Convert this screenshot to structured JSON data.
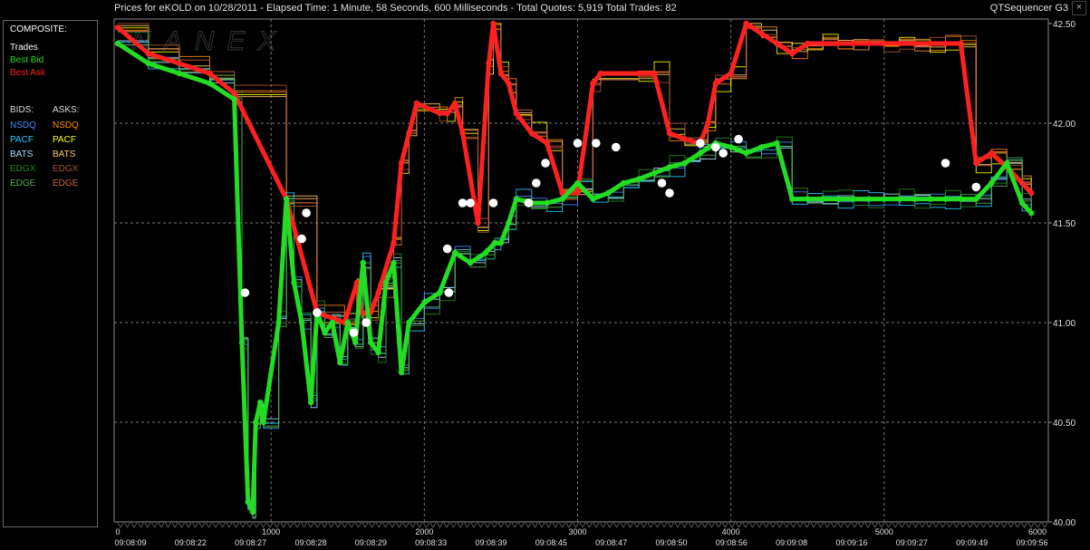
{
  "header": {
    "title": "Prices for  eKOLD  on  10/28/2011  -  Elapsed Time: 1 Minute, 58 Seconds, 600 Milliseconds  -  Total Quotes: 5,919  Total Trades: 82",
    "app_name": "QTSequencer G3",
    "close_glyph": "×"
  },
  "watermark": "NANEX",
  "legend": {
    "composite_label": "COMPOSITE:",
    "trades": "Trades",
    "best_bid": "Best Bid",
    "best_ask": "Best Ask",
    "bids_label": "BIDS:",
    "asks_label": "ASKS:",
    "bids": [
      "NSDQ",
      "PACF",
      "BATS",
      "EDGX",
      "EDGE"
    ],
    "asks": [
      "NSDQ",
      "PACF",
      "BATS",
      "EDGX",
      "EDGE"
    ]
  },
  "colors": {
    "trades": "#ffffff",
    "best_bid": "#22dd22",
    "best_ask": "#ff2020",
    "NSDQ_bid": "#4488ff",
    "NSDQ_ask": "#ff8800",
    "PACF_bid": "#22ccff",
    "PACF_ask": "#ffff00",
    "BATS_bid": "#aaddff",
    "BATS_ask": "#ffcc66",
    "EDGX_bid": "#228822",
    "EDGX_ask": "#aa5533",
    "EDGE_bid": "#55aa55",
    "EDGE_ask": "#cc6644"
  },
  "chart_data": {
    "type": "line",
    "ylim": [
      40.0,
      42.5
    ],
    "xlim": [
      0,
      6000
    ],
    "y_ticks": [
      "42.50",
      "42.00",
      "41.50",
      "41.00",
      "40.50",
      "40.00"
    ],
    "x_ticks": [
      "0",
      "1000",
      "2000",
      "3000",
      "4000",
      "5000",
      "6000"
    ],
    "time_labels": [
      "09:08:09",
      "09:08:22",
      "09:08:27",
      "09:08:28",
      "09:08:29",
      "09:08:33",
      "09:08:39",
      "09:08:45",
      "09:08:47",
      "09:08:50",
      "09:08:56",
      "09:09:08",
      "09:09:16",
      "09:09:27",
      "09:09:49",
      "09:09:56"
    ],
    "grid": true,
    "series": [
      {
        "name": "Best Bid",
        "x": [
          0,
          200,
          400,
          600,
          760,
          810,
          850,
          880,
          900,
          930,
          950,
          1050,
          1100,
          1150,
          1200,
          1260,
          1300,
          1350,
          1400,
          1450,
          1500,
          1550,
          1600,
          1650,
          1700,
          1750,
          1800,
          1850,
          1900,
          2000,
          2100,
          2200,
          2300,
          2400,
          2460,
          2500,
          2550,
          2600,
          2700,
          2800,
          2900,
          3000,
          3100,
          3200,
          3300,
          3400,
          3500,
          3600,
          3700,
          3800,
          3900,
          4000,
          4100,
          4200,
          4300,
          4400,
          4500,
          4600,
          4700,
          4800,
          4900,
          5000,
          5100,
          5200,
          5300,
          5400,
          5500,
          5600,
          5700,
          5800,
          5900,
          5960
        ],
        "y": [
          42.4,
          42.3,
          42.25,
          42.2,
          42.12,
          40.9,
          40.1,
          40.05,
          40.5,
          40.6,
          40.5,
          41.0,
          41.62,
          41.2,
          41.0,
          40.6,
          41.05,
          40.95,
          41.0,
          40.8,
          41.0,
          40.9,
          41.3,
          40.9,
          40.85,
          41.2,
          41.3,
          40.75,
          41.0,
          41.1,
          41.15,
          41.35,
          41.3,
          41.35,
          41.4,
          41.4,
          41.5,
          41.62,
          41.6,
          41.6,
          41.62,
          41.7,
          41.62,
          41.65,
          41.7,
          41.72,
          41.75,
          41.78,
          41.8,
          41.85,
          41.9,
          41.88,
          41.85,
          41.88,
          41.9,
          41.62,
          41.62,
          41.62,
          41.62,
          41.62,
          41.62,
          41.62,
          41.62,
          41.62,
          41.62,
          41.62,
          41.62,
          41.62,
          41.7,
          41.8,
          41.6,
          41.55
        ]
      },
      {
        "name": "Best Ask",
        "x": [
          0,
          200,
          400,
          600,
          760,
          1100,
          1300,
          1480,
          1560,
          1590,
          1650,
          1700,
          1800,
          1850,
          1900,
          1950,
          2100,
          2150,
          2200,
          2250,
          2350,
          2420,
          2450,
          2500,
          2550,
          2600,
          2700,
          2800,
          2900,
          3000,
          3100,
          3150,
          3400,
          3500,
          3600,
          3700,
          3800,
          3850,
          3900,
          4000,
          4100,
          4200,
          4300,
          4400,
          4500,
          4600,
          4700,
          4800,
          4900,
          5000,
          5100,
          5200,
          5300,
          5400,
          5500,
          5600,
          5700,
          5800,
          5900,
          5960
        ],
        "y": [
          42.48,
          42.35,
          42.3,
          42.25,
          42.15,
          41.62,
          41.05,
          41.0,
          41.2,
          41.05,
          41.05,
          41.15,
          41.4,
          41.8,
          41.95,
          42.1,
          42.05,
          42.05,
          42.1,
          41.95,
          41.5,
          42.3,
          42.5,
          42.25,
          42.2,
          42.05,
          41.95,
          41.9,
          41.65,
          41.65,
          42.2,
          42.25,
          42.25,
          42.25,
          41.95,
          41.92,
          41.9,
          42.0,
          42.2,
          42.25,
          42.5,
          42.45,
          42.4,
          42.35,
          42.4,
          42.4,
          42.4,
          42.4,
          42.4,
          42.4,
          42.4,
          42.4,
          42.4,
          42.4,
          42.4,
          41.8,
          41.85,
          41.78,
          41.7,
          41.65
        ]
      },
      {
        "name": "Trades",
        "x": [
          830,
          1200,
          1230,
          1300,
          1540,
          1620,
          2150,
          2160,
          2250,
          2300,
          2450,
          2680,
          2730,
          2790,
          3000,
          3120,
          3250,
          3550,
          3600,
          3800,
          3900,
          3950,
          4050,
          5400,
          5600
        ],
        "y": [
          41.15,
          41.42,
          41.55,
          41.05,
          40.95,
          41.0,
          41.37,
          41.15,
          41.6,
          41.6,
          41.6,
          41.6,
          41.7,
          41.8,
          41.9,
          41.9,
          41.88,
          41.7,
          41.65,
          41.9,
          41.88,
          41.85,
          41.92,
          41.8,
          41.68
        ]
      }
    ]
  }
}
